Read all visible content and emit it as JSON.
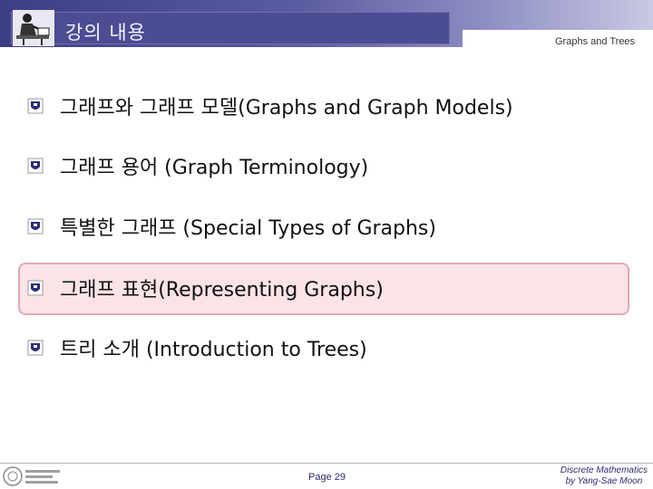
{
  "header": {
    "title": "강의 내용",
    "subtitle": "Graphs and Trees",
    "icon": "person-at-desk-icon"
  },
  "content": {
    "bullet_icon": "emblem-bullet-icon",
    "items": [
      {
        "label": "그래프와 그래프 모델(Graphs and Graph Models)",
        "highlighted": false
      },
      {
        "label": "그래프 용어 (Graph Terminology)",
        "highlighted": false
      },
      {
        "label": "특별한 그래프 (Special Types of Graphs)",
        "highlighted": false
      },
      {
        "label": "그래프 표현(Representing Graphs)",
        "highlighted": true
      },
      {
        "label": "트리 소개 (Introduction to Trees)",
        "highlighted": false
      }
    ]
  },
  "footer": {
    "logo": "university-logo",
    "page": "Page 29",
    "credit_line1": "Discrete Mathematics",
    "credit_line2": "by Yang-Sae Moon"
  },
  "colors": {
    "header": "#4c4c92",
    "highlight_fill": "#fbe3e7",
    "highlight_border": "#e3a9b6"
  }
}
